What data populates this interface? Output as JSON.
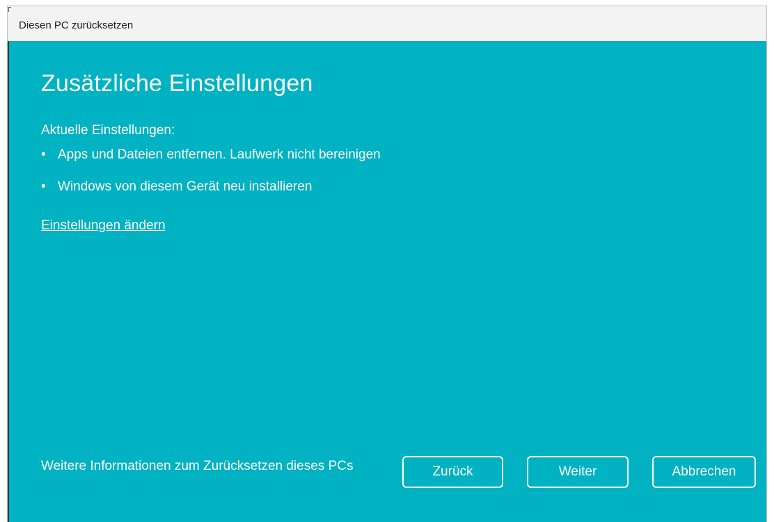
{
  "window": {
    "title": "Diesen PC zurücksetzen"
  },
  "page": {
    "heading": "Zusätzliche Einstellungen",
    "current_settings_label": "Aktuelle Einstellungen:",
    "settings": [
      "Apps und Dateien entfernen. Laufwerk nicht bereinigen",
      "Windows von diesem Gerät neu installieren"
    ],
    "bullet_char": "•",
    "change_settings_link": "Einstellungen ändern"
  },
  "footer": {
    "info_link": "Weitere Informationen zum Zurücksetzen dieses PCs",
    "back_label": "Zurück",
    "next_label": "Weiter",
    "cancel_label": "Abbrechen"
  },
  "colors": {
    "accent_background": "#00b2c2",
    "titlebar_background": "#f3f3f3",
    "text": "#ffffff"
  }
}
